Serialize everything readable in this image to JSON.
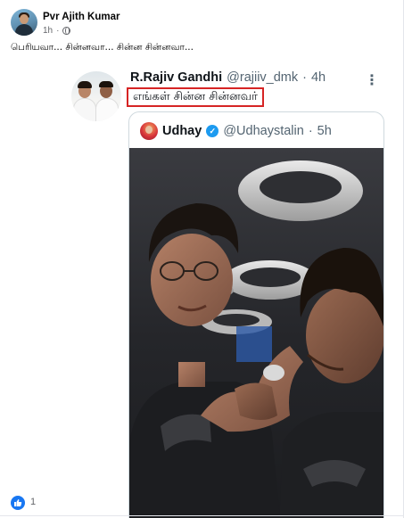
{
  "post": {
    "author": "Pvr Ajith Kumar",
    "time": "1h",
    "text": "பெரியவா... சின்னவா... சின்ன சின்னவா..."
  },
  "tweet": {
    "name": "R.Rajiv Gandhi",
    "handle": "@rajiiv_dmk",
    "separator": "·",
    "time": "4h",
    "text": "எங்கள் சின்ன சின்னவர்",
    "more_icon": "more-horizontal-icon",
    "highlight_color": "#d62424"
  },
  "quoted": {
    "name": "Udhay",
    "verified_icon": "verified-badge-icon",
    "verified_color": "#1d9bf0",
    "handle": "@Udhaystalin",
    "separator": "·",
    "time": "5h"
  },
  "reactions": {
    "icon": "like-icon",
    "color": "#1877f2",
    "count": "1"
  }
}
